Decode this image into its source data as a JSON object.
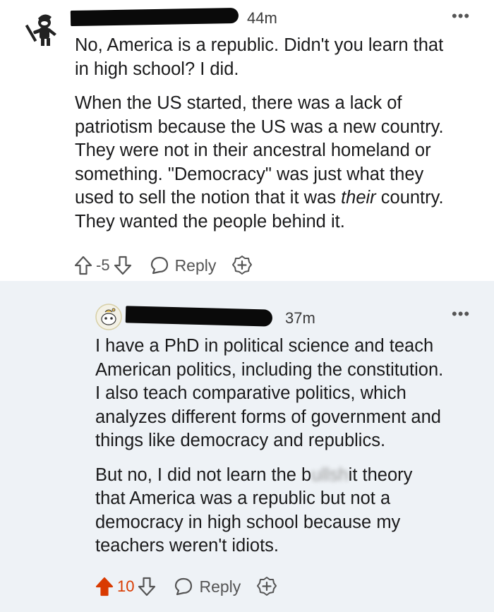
{
  "comments": [
    {
      "time": "44m",
      "paragraphs": [
        "No, America is a republic. Didn't you learn that\nin high school? I did.",
        "When the US started, there was a lack of\npatriotism because the US was a new country.\nThey were not in their ancestral homeland or\nsomething. \"Democracy\" was just what they\nused to sell the notion that it was ",
        "their",
        " country.\nThey wanted the people behind it."
      ],
      "score": "-5",
      "reply_label": "Reply",
      "upvoted": false
    },
    {
      "time": "37m",
      "paragraphs": [
        "I have a PhD in political science and teach\nAmerican politics, including the constitution.\nI also teach comparative politics, which\nanalyzes different forms of government and\nthings like democracy and republics.",
        "But no, I did not learn the b",
        "ullsh",
        "it theory\nthat America was a republic but not a\ndemocracy in high school because my\nteachers weren't idiots."
      ],
      "score": "10",
      "reply_label": "Reply",
      "upvoted": true
    }
  ],
  "icons": {
    "more": "more-options-icon",
    "upvote": "upvote-arrow-icon",
    "downvote": "downvote-arrow-icon",
    "reply": "reply-bubble-icon",
    "award": "award-plus-icon"
  },
  "colors": {
    "upvote_active": "#d93a00",
    "thread_background": "#eef2f6"
  }
}
